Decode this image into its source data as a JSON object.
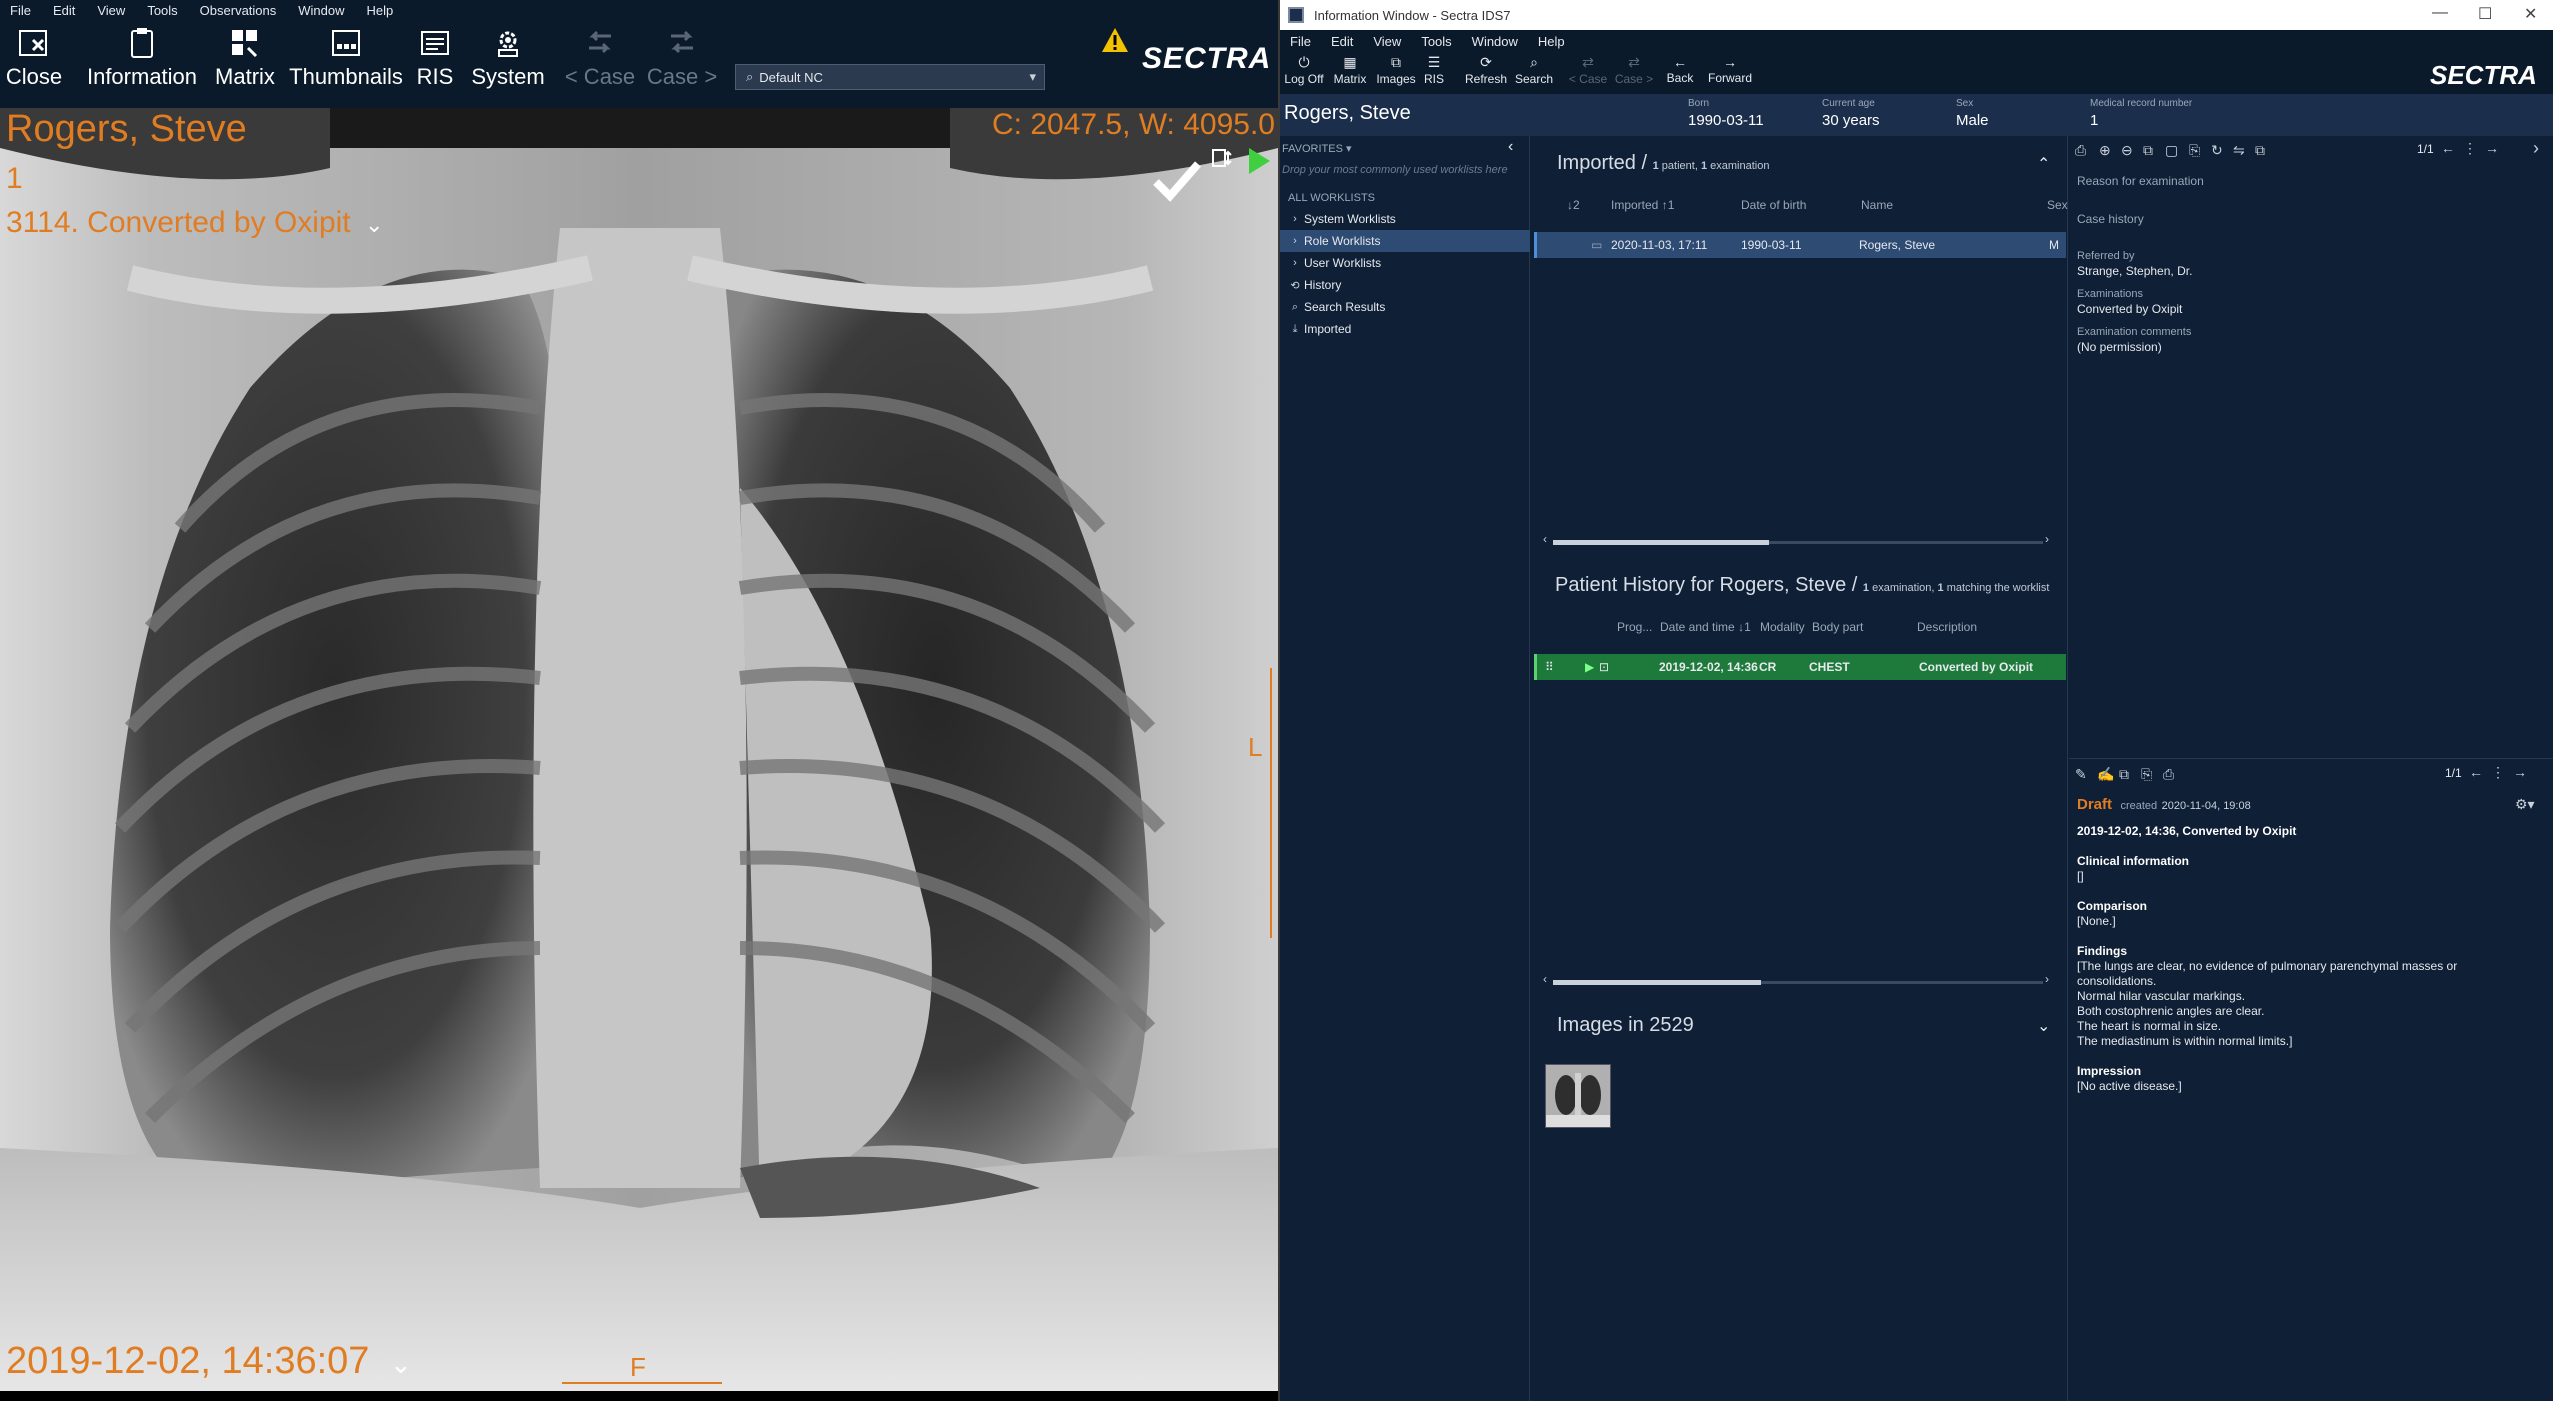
{
  "viewer": {
    "menu": [
      "File",
      "Edit",
      "View",
      "Tools",
      "Observations",
      "Window",
      "Help"
    ],
    "toolbar": {
      "close": "Close",
      "information": "Information",
      "matrix": "Matrix",
      "thumbnails": "Thumbnails",
      "ris": "RIS",
      "system": "System",
      "prev_case": "< Case",
      "next_case": "Case >"
    },
    "hanging_protocol": "Default NC",
    "brand": "SECTRA",
    "overlay": {
      "patient_name": "Rogers, Steve",
      "series_number": "1",
      "series_desc": "3114. Converted by Oxipit",
      "window_level": "C: 2047.5, W: 4095.0",
      "study_datetime": "2019-12-02, 14:36:07",
      "orientation_right": "L",
      "orientation_bottom": "F"
    },
    "colors": {
      "overlay": "#e07d22",
      "accent_green": "#3fcf3f"
    }
  },
  "info": {
    "title": "Information Window - Sectra IDS7",
    "menu": [
      "File",
      "Edit",
      "View",
      "Tools",
      "Window",
      "Help"
    ],
    "toolbar": {
      "log_off": "Log Off",
      "matrix": "Matrix",
      "images": "Images",
      "ris": "RIS",
      "refresh": "Refresh",
      "search": "Search",
      "prev_case": "< Case",
      "next_case": "Case >",
      "back": "Back",
      "forward": "Forward"
    },
    "brand": "SECTRA",
    "patient": {
      "name": "Rogers, Steve",
      "born_label": "Born",
      "born": "1990-03-11",
      "age_label": "Current age",
      "age": "30 years",
      "sex_label": "Sex",
      "sex": "Male",
      "mrn_label": "Medical record number",
      "mrn": "1"
    },
    "worklists": {
      "favorites": "FAVORITES",
      "favorites_hint": "Drop your most commonly used worklists here",
      "all_title": "ALL WORKLISTS",
      "items": [
        {
          "label": "System Worklists",
          "icon": "chevron-right-icon"
        },
        {
          "label": "Role Worklists",
          "icon": "chevron-right-icon"
        },
        {
          "label": "User Worklists",
          "icon": "chevron-right-icon"
        },
        {
          "label": "History",
          "icon": "history-icon"
        },
        {
          "label": "Search Results",
          "icon": "search-icon"
        },
        {
          "label": "Imported",
          "icon": "import-icon"
        }
      ]
    },
    "imported": {
      "title": "Imported",
      "count_patients": "1",
      "count_patients_label": "patient,",
      "count_exams": "1",
      "count_exams_label": "examination",
      "columns": {
        "sort_idx": "2",
        "imported": "Imported",
        "dob": "Date of birth",
        "name": "Name",
        "sex": "Sex"
      },
      "row": {
        "imported": "2020-11-03, 17:11",
        "dob": "1990-03-11",
        "name": "Rogers, Steve",
        "sex": "M"
      }
    },
    "history": {
      "title": "Patient History for Rogers, Steve",
      "count": "1",
      "count_label": "examination,",
      "match": "1",
      "match_label": "matching the worklist",
      "columns": {
        "prog": "Prog...",
        "datetime": "Date and time",
        "modality": "Modality",
        "body_part": "Body part",
        "description": "Description"
      },
      "row": {
        "datetime": "2019-12-02, 14:36",
        "modality": "CR",
        "body_part": "CHEST",
        "description": "Converted by Oxipit"
      }
    },
    "images": {
      "title": "Images in 2529"
    },
    "exam_info": {
      "pager": "1/1",
      "reason_label": "Reason for examination",
      "case_history_label": "Case history",
      "referred_label": "Referred by",
      "referred": "Strange, Stephen, Dr.",
      "exams_label": "Examinations",
      "exams": "Converted by Oxipit",
      "comments_label": "Examination comments",
      "comments": "(No permission)"
    },
    "report": {
      "pager": "1/1",
      "status": "Draft",
      "created_label": "created",
      "created": "2020-11-04, 19:08",
      "heading": "2019-12-02, 14:36, Converted by Oxipit",
      "clinical_h": "Clinical information",
      "clinical": "[]",
      "comparison_h": "Comparison",
      "comparison": "[None.]",
      "findings_h": "Findings",
      "findings": [
        "[The lungs are clear, no evidence of pulmonary parenchymal masses or",
        "consolidations.",
        "Normal hilar vascular markings.",
        "Both costophrenic angles are clear.",
        "The heart is normal in size.",
        "The mediastinum is within normal limits.]"
      ],
      "impression_h": "Impression",
      "impression": "[No active disease.]"
    }
  }
}
